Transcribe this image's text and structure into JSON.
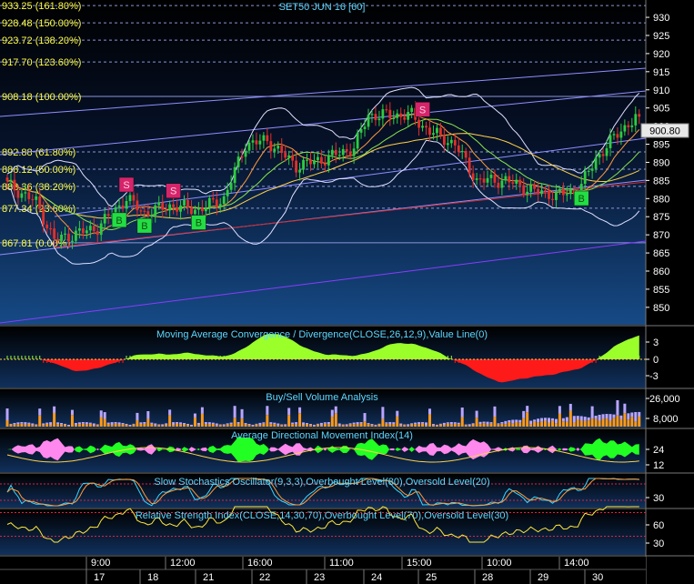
{
  "main_panel": {
    "title": "SET50 JUN 16 [60]",
    "current_price": "900.80",
    "fib_levels": [
      {
        "label": "933.25 (161.80%)",
        "price": 933.25,
        "label_shown": true
      },
      {
        "label": "928.48 (150.00%)",
        "price": 928.48,
        "label_shown": true
      },
      {
        "label": "923.72 (138.20%)",
        "price": 923.72,
        "label_shown": true
      },
      {
        "label": "917.70 (123.60%)",
        "price": 917.7,
        "label_shown": true
      },
      {
        "label": "908.18 (100.00%)",
        "price": 908.18,
        "label_shown": true
      },
      {
        "label": "892.88 (61.80%)",
        "price": 892.88,
        "label_shown": true
      },
      {
        "label": "888.12 (50.00%)",
        "price": 888.12,
        "label_shown": true
      },
      {
        "label": "883.36 (38.20%)",
        "price": 883.36,
        "label_shown": true
      },
      {
        "label": "877.34 (23.60%)",
        "price": 877.34,
        "label_shown": true
      },
      {
        "label": "867.81 (0.00%)",
        "price": 867.81,
        "label_shown": true
      }
    ],
    "y_ticks": [
      "930",
      "925",
      "920",
      "915",
      "910",
      "905",
      "900",
      "895",
      "890",
      "885",
      "880",
      "875",
      "870",
      "865",
      "860",
      "855",
      "850"
    ],
    "signals": [
      {
        "type": "S",
        "label": "S",
        "bar": 33
      },
      {
        "type": "S",
        "label": "S",
        "bar": 46
      },
      {
        "type": "S",
        "label": "S",
        "bar": 115
      },
      {
        "type": "B",
        "label": "B",
        "bar": 31
      },
      {
        "type": "B",
        "label": "B",
        "bar": 38
      },
      {
        "type": "B",
        "label": "B",
        "bar": 53
      },
      {
        "type": "B",
        "label": "B",
        "bar": 159
      }
    ]
  },
  "indicators": [
    {
      "title": "Moving Average Convergence / Divergence(CLOSE,26,12,9),Value Line(0)",
      "ticks": [
        "3",
        "0",
        "-3"
      ]
    },
    {
      "title": "Buy/Sell Volume Analysis",
      "ticks": [
        "26,000",
        "8,000"
      ]
    },
    {
      "title": "Average Directional Movement Index(14)",
      "ticks": [
        "24",
        "12"
      ]
    },
    {
      "title": "Slow Stochastics Oscillator(9,3,3),Overbought Level(80),Oversold Level(20)",
      "ticks": [
        "30"
      ]
    },
    {
      "title": "Relative Strength Index(CLOSE,14,30,70),Overbought Level(70),Oversold Level(30)",
      "ticks": [
        "60",
        "30"
      ]
    }
  ],
  "time_axis": {
    "times": [
      {
        "label": "9:00",
        "x": 100
      },
      {
        "label": "12:00",
        "x": 187
      },
      {
        "label": "16:00",
        "x": 272
      },
      {
        "label": "11:00",
        "x": 362
      },
      {
        "label": "15:00",
        "x": 447
      },
      {
        "label": "10:00",
        "x": 535
      },
      {
        "label": "14:00",
        "x": 620
      }
    ],
    "dates": [
      {
        "label": "17",
        "x": 98
      },
      {
        "label": "18",
        "x": 157
      },
      {
        "label": "21",
        "x": 218
      },
      {
        "label": "22",
        "x": 280
      },
      {
        "label": "23",
        "x": 340
      },
      {
        "label": "24",
        "x": 403
      },
      {
        "label": "25",
        "x": 463
      },
      {
        "label": "28",
        "x": 525
      },
      {
        "label": "29",
        "x": 586
      },
      {
        "label": "30",
        "x": 646
      }
    ]
  },
  "colors": {
    "bull_candle": "#2ecc40",
    "bear_candle": "#e0302a",
    "sell_signal": "#d6246b",
    "buy_signal": "#22dd44",
    "macd_positive": "#9bff2a",
    "macd_negative": "#ff1a1a",
    "adx_up": "#22ff22",
    "adx_down": "#ff88ee"
  }
}
